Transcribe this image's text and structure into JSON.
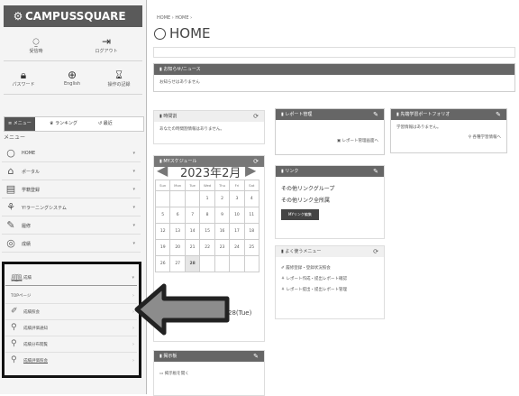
{
  "sidebar": {
    "logo": "CAMPUSSQUARE",
    "top_buttons": [
      {
        "icon": "user-icon",
        "label": "受信時"
      },
      {
        "icon": "logout-icon",
        "label": "ログアウト"
      },
      {
        "icon": "lock-icon",
        "label": "パスワード"
      },
      {
        "icon": "globe-icon",
        "label": "English"
      },
      {
        "icon": "hourglass-icon",
        "label": "操作の記録"
      }
    ],
    "menu_tabs": [
      "メニュー",
      "ランキング",
      "最近"
    ],
    "menu_heading": "メニュー",
    "nav_items": [
      {
        "icon": "circle-icon",
        "label": "HOME"
      },
      {
        "icon": "portal-icon",
        "label": "ポータル"
      },
      {
        "icon": "register-icon",
        "label": "学籍登録"
      },
      {
        "icon": "learning-system-icon",
        "label": "Y!ラーニングシステム"
      },
      {
        "icon": "edit-icon",
        "label": "履修"
      },
      {
        "icon": "grade-icon",
        "label": "成績"
      }
    ],
    "highlighted_group": {
      "title": "成績",
      "items": [
        {
          "icon": "",
          "label": "TOPページ"
        },
        {
          "icon": "pencil-icon",
          "label": "成績照会"
        },
        {
          "icon": "search-icon",
          "label": "成績評価通知"
        },
        {
          "icon": "search-icon",
          "label": "成績分布閲覧"
        },
        {
          "icon": "search-icon",
          "label": "成績評価照会"
        }
      ]
    }
  },
  "header": {
    "breadcrumb": "HOME › HOME ›",
    "title": "HOME"
  },
  "panels": {
    "news": {
      "title": "お知らせ/ニュース",
      "body": "お知らせはありません"
    },
    "profile": {
      "title": "時間割",
      "body": "あなたの時間割情報はありません。"
    },
    "report": {
      "title": "レポート管理",
      "link": "レポート管理画面へ"
    },
    "portfolio": {
      "title": "先端学習ポートフォリオ",
      "body": "学習情報はありません。",
      "link": "各種学習情報へ"
    },
    "calendar": {
      "title": "MYスケジュール",
      "month": "2023年2月",
      "days": [
        "Sun",
        "Mon",
        "Tue",
        "Wed",
        "Thu",
        "Fri",
        "Sat"
      ],
      "weeks": [
        [
          "",
          "",
          "",
          "1",
          "2",
          "3",
          "4"
        ],
        [
          "5",
          "6",
          "7",
          "8",
          "9",
          "10",
          "11"
        ],
        [
          "12",
          "13",
          "14",
          "15",
          "16",
          "17",
          "18"
        ],
        [
          "19",
          "20",
          "21",
          "22",
          "23",
          "24",
          "25"
        ],
        [
          "26",
          "27",
          "28",
          "",
          "",
          "",
          ""
        ]
      ],
      "selected_date": "2023/2/28(Tue)"
    },
    "links": {
      "title": "リンク",
      "items": [
        "その他リンクグループ",
        "その他リンク全所属"
      ],
      "button": "MYリンク編集"
    },
    "favorites": {
      "title": "よく使うメニュー",
      "items": [
        "履修登録・登録状況照会",
        "レポート作成・提出レポート確認",
        "レポート提出・提出レポート管理"
      ]
    },
    "notice": {
      "title": "掲示板",
      "item": "掲示板を開く"
    }
  }
}
